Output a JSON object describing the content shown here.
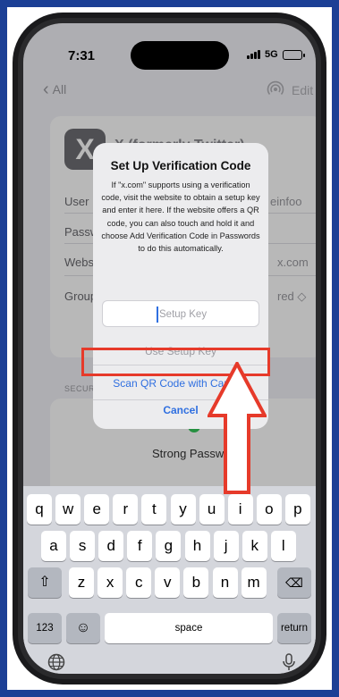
{
  "status_bar": {
    "time": "7:31",
    "network": "5G"
  },
  "nav": {
    "back_label": "All",
    "edit_label": "Edit"
  },
  "card": {
    "logo_letter": "X",
    "title": "X (formerly Twitter)",
    "rows": [
      {
        "label": "User",
        "value": "einfoo"
      },
      {
        "label": "Passw",
        "value": ""
      },
      {
        "label": "Webs",
        "value": "x.com"
      },
      {
        "label": "Group",
        "value": "red ◇"
      }
    ]
  },
  "security": {
    "header": "SECUR",
    "status": "Strong Password"
  },
  "alert": {
    "title": "Set Up Verification Code",
    "message": "If \"x.com\" supports using a verification code, visit the website to obtain a setup key and enter it here. If the website offers a QR code, you can also touch and hold it and choose Add Verification Code in Passwords to do this automatically.",
    "input_placeholder": "Setup Key",
    "use_key_label": "Use Setup Key",
    "scan_label": "Scan QR Code with Camera",
    "cancel_label": "Cancel"
  },
  "keyboard": {
    "row1": [
      "q",
      "w",
      "e",
      "r",
      "t",
      "y",
      "u",
      "i",
      "o",
      "p"
    ],
    "row2": [
      "a",
      "s",
      "d",
      "f",
      "g",
      "h",
      "j",
      "k",
      "l"
    ],
    "row3": [
      "z",
      "x",
      "c",
      "v",
      "b",
      "n",
      "m"
    ],
    "numbers_label": "123",
    "space_label": "space",
    "return_label": "return"
  },
  "colors": {
    "frame": "#1c3f95",
    "link": "#2f6fe0",
    "highlight": "#e63a2a"
  }
}
